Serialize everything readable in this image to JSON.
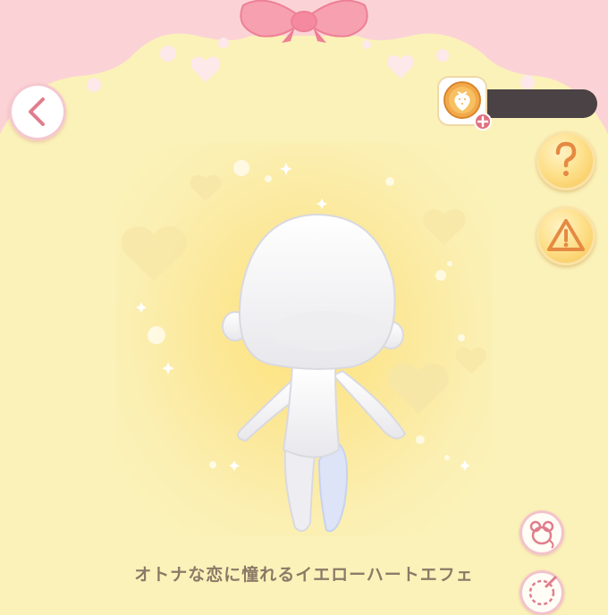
{
  "effect": {
    "name": "オトナな恋に憧れるイエローハートエフェ"
  },
  "currency": {
    "amount": ""
  },
  "icons": {
    "back": "chevron-left-icon",
    "coin": "strawberry-coin-icon",
    "add": "plus-icon",
    "help": "question-mark-icon",
    "warning": "warning-triangle-icon",
    "mouse": "mouse-icon",
    "palette": "palette-icon"
  },
  "colors": {
    "background": "#fbf2b9",
    "ribbon": "#f6a0b0",
    "accent_pink": "#e0707f",
    "gold": "#f6bf4a",
    "text": "#8b7a67"
  }
}
